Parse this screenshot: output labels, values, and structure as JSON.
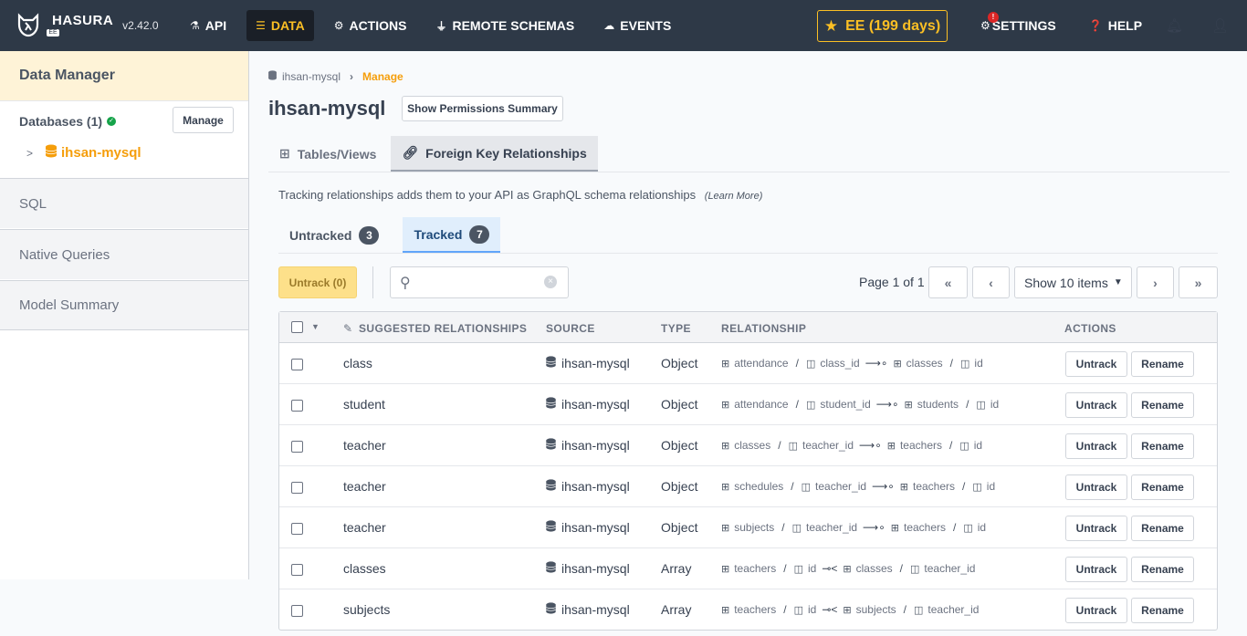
{
  "nav": {
    "brand": "HASURA",
    "brand_tag": "EE",
    "version": "v2.42.0",
    "items": [
      {
        "label": "API",
        "icon": "flask-icon"
      },
      {
        "label": "DATA",
        "icon": "database-icon",
        "active": true
      },
      {
        "label": "ACTIONS",
        "icon": "cogs-icon"
      },
      {
        "label": "REMOTE SCHEMAS",
        "icon": "plug-icon"
      },
      {
        "label": "EVENTS",
        "icon": "cloud-icon"
      }
    ],
    "ee_label": "EE (199 days)",
    "settings_label": "SETTINGS",
    "settings_badge": "!",
    "help_label": "HELP"
  },
  "sidebar": {
    "title": "Data Manager",
    "databases_label": "Databases (1)",
    "manage_label": "Manage",
    "db_name": "ihsan-mysql",
    "sections": [
      "SQL",
      "Native Queries",
      "Model Summary"
    ]
  },
  "breadcrumb": {
    "db": "ihsan-mysql",
    "current": "Manage"
  },
  "page": {
    "title": "ihsan-mysql",
    "perm_button": "Show Permissions Summary",
    "tabs": [
      {
        "label": "Tables/Views",
        "icon": "table-icon"
      },
      {
        "label": "Foreign Key Relationships",
        "icon": "link-icon",
        "active": true
      }
    ],
    "description": "Tracking relationships adds them to your API as GraphQL schema relationships",
    "learn_more": "(Learn More)",
    "subtabs": [
      {
        "label": "Untracked",
        "count": "3"
      },
      {
        "label": "Tracked",
        "count": "7",
        "active": true
      }
    ],
    "untrack_all": "Untrack (0)",
    "search_placeholder": "",
    "page_info": "Page 1 of 1",
    "show_items": "Show 10 items"
  },
  "table": {
    "headers": {
      "suggested": "SUGGESTED RELATIONSHIPS",
      "source": "SOURCE",
      "type": "TYPE",
      "relationship": "RELATIONSHIP",
      "actions": "ACTIONS"
    },
    "untrack_label": "Untrack",
    "rename_label": "Rename",
    "rows": [
      {
        "name": "class",
        "source": "ihsan-mysql",
        "type": "Object",
        "from_table": "attendance",
        "from_col": "class_id",
        "to_table": "classes",
        "to_col": "id"
      },
      {
        "name": "student",
        "source": "ihsan-mysql",
        "type": "Object",
        "from_table": "attendance",
        "from_col": "student_id",
        "to_table": "students",
        "to_col": "id"
      },
      {
        "name": "teacher",
        "source": "ihsan-mysql",
        "type": "Object",
        "from_table": "classes",
        "from_col": "teacher_id",
        "to_table": "teachers",
        "to_col": "id"
      },
      {
        "name": "teacher",
        "source": "ihsan-mysql",
        "type": "Object",
        "from_table": "schedules",
        "from_col": "teacher_id",
        "to_table": "teachers",
        "to_col": "id"
      },
      {
        "name": "teacher",
        "source": "ihsan-mysql",
        "type": "Object",
        "from_table": "subjects",
        "from_col": "teacher_id",
        "to_table": "teachers",
        "to_col": "id"
      },
      {
        "name": "classes",
        "source": "ihsan-mysql",
        "type": "Array",
        "from_table": "teachers",
        "from_col": "id",
        "to_table": "classes",
        "to_col": "teacher_id"
      },
      {
        "name": "subjects",
        "source": "ihsan-mysql",
        "type": "Array",
        "from_table": "teachers",
        "from_col": "id",
        "to_table": "subjects",
        "to_col": "teacher_id"
      }
    ]
  }
}
